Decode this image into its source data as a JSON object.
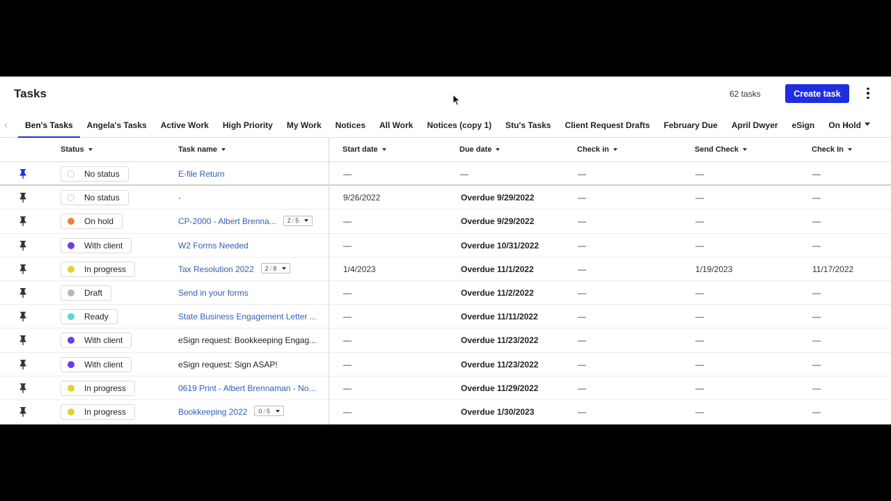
{
  "header": {
    "title": "Tasks",
    "task_count": "62 tasks",
    "create_label": "Create task"
  },
  "tabs": [
    {
      "label": "Ben's Tasks",
      "active": true
    },
    {
      "label": "Angela's Tasks"
    },
    {
      "label": "Active Work"
    },
    {
      "label": "High Priority"
    },
    {
      "label": "My Work"
    },
    {
      "label": "Notices"
    },
    {
      "label": "All Work"
    },
    {
      "label": "Notices (copy 1)"
    },
    {
      "label": "Stu's Tasks"
    },
    {
      "label": "Client Request Drafts"
    },
    {
      "label": "February Due"
    },
    {
      "label": "April Dwyer"
    },
    {
      "label": "eSign"
    },
    {
      "label": "On Hold"
    }
  ],
  "columns": {
    "status": "Status",
    "task_name": "Task name",
    "start_date": "Start date",
    "due_date": "Due date",
    "check_in": "Check in",
    "send_check": "Send Check",
    "check_in_2": "Check In"
  },
  "colors": {
    "accent": "#1f2fe0",
    "link": "#2f5fb5",
    "no_status": "#ffffff",
    "on_hold": "#e8843a",
    "with_client": "#6f3be8",
    "in_progress": "#e8cf2b",
    "draft": "#bdb6ad",
    "ready": "#5ed8c8"
  },
  "rows": [
    {
      "status": "No status",
      "color": "#ffffff",
      "task": "E-file Return",
      "link": true,
      "badge": null,
      "start": "—",
      "due": "—",
      "due_bold": false,
      "check_in": "—",
      "send_check": "—",
      "check_in_2": "—"
    },
    {
      "status": "No status",
      "color": "#ffffff",
      "task": "-",
      "link": true,
      "badge": null,
      "start": "9/26/2022",
      "due": "Overdue 9/29/2022",
      "due_bold": true,
      "check_in": "—",
      "send_check": "—",
      "check_in_2": "—"
    },
    {
      "status": "On hold",
      "color": "#e8843a",
      "task": "CP-2000 - Albert Brenna...",
      "link": true,
      "badge": {
        "done": "2",
        "total": "5"
      },
      "start": "—",
      "due": "Overdue 9/29/2022",
      "due_bold": true,
      "check_in": "—",
      "send_check": "—",
      "check_in_2": "—"
    },
    {
      "status": "With client",
      "color": "#6f3be8",
      "task": "W2 Forms Needed",
      "link": true,
      "badge": null,
      "start": "—",
      "due": "Overdue 10/31/2022",
      "due_bold": true,
      "check_in": "—",
      "send_check": "—",
      "check_in_2": "—"
    },
    {
      "status": "In progress",
      "color": "#e8cf2b",
      "task": "Tax Resolution 2022",
      "link": true,
      "badge": {
        "done": "2",
        "total": "8"
      },
      "start": "1/4/2023",
      "due": "Overdue 11/1/2022",
      "due_bold": true,
      "check_in": "—",
      "send_check": "1/19/2023",
      "check_in_2": "11/17/2022"
    },
    {
      "status": "Draft",
      "color": "#bdb6ad",
      "task": "Send in your forms",
      "link": true,
      "badge": null,
      "start": "—",
      "due": "Overdue 11/2/2022",
      "due_bold": true,
      "check_in": "—",
      "send_check": "—",
      "check_in_2": "—"
    },
    {
      "status": "Ready",
      "color": "#5ed8c8",
      "task": "State Business Engagement Letter ...",
      "link": true,
      "badge": null,
      "start": "—",
      "due": "Overdue 11/11/2022",
      "due_bold": true,
      "check_in": "—",
      "send_check": "—",
      "check_in_2": "—"
    },
    {
      "status": "With client",
      "color": "#6f3be8",
      "task": "eSign request: Bookkeeping Engag...",
      "link": false,
      "badge": null,
      "start": "—",
      "due": "Overdue 11/23/2022",
      "due_bold": true,
      "check_in": "—",
      "send_check": "—",
      "check_in_2": "—"
    },
    {
      "status": "With client",
      "color": "#6f3be8",
      "task": "eSign request: Sign ASAP!",
      "link": false,
      "badge": null,
      "start": "—",
      "due": "Overdue 11/23/2022",
      "due_bold": true,
      "check_in": "—",
      "send_check": "—",
      "check_in_2": "—"
    },
    {
      "status": "In progress",
      "color": "#e8cf2b",
      "task": "0619 Print - Albert Brennaman - No...",
      "link": true,
      "badge": null,
      "start": "—",
      "due": "Overdue 11/29/2022",
      "due_bold": true,
      "check_in": "—",
      "send_check": "—",
      "check_in_2": "—"
    },
    {
      "status": "In progress",
      "color": "#e8cf2b",
      "task": "Bookkeeping 2022",
      "link": true,
      "badge": {
        "done": "0",
        "total": "5"
      },
      "start": "—",
      "due": "Overdue 1/30/2023",
      "due_bold": true,
      "check_in": "—",
      "send_check": "—",
      "check_in_2": "—"
    }
  ]
}
